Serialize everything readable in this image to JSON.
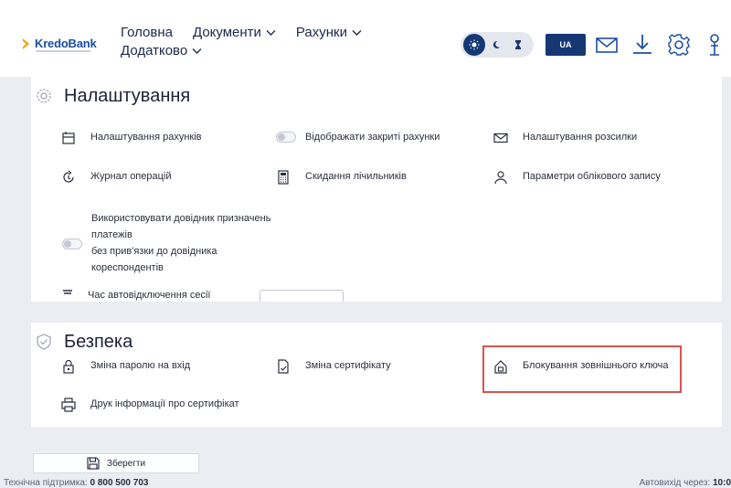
{
  "app": {
    "logo_text": "KredoBank",
    "colors": {
      "brand": "#1b4ea3",
      "brand_dark": "#153875",
      "accent": "#f5a500",
      "highlight": "#d9534f"
    }
  },
  "nav": {
    "home": "Головна",
    "documents": "Документи",
    "accounts": "Рахунки",
    "extra": "Додатково"
  },
  "header": {
    "lang": "UA",
    "theme_modes": [
      "sun",
      "moon",
      "hourglass"
    ],
    "icons": [
      "mail-icon",
      "download-icon",
      "gear-icon",
      "user-icon"
    ]
  },
  "settings": {
    "title": "Налаштування",
    "items": [
      {
        "label": "Налаштування рахунків",
        "icon": "account-settings-icon"
      },
      {
        "label": "Відображати закриті рахунки",
        "icon": "toggle"
      },
      {
        "label": "Налаштування розсилки",
        "icon": "envelope-icon"
      },
      {
        "label": "Журнал операцій",
        "icon": "history-icon"
      },
      {
        "label": "Скидання лічильників",
        "icon": "calculator-icon"
      },
      {
        "label": "Параметри облікового запису",
        "icon": "person-icon"
      }
    ],
    "directory_lines": [
      "Використовувати довідник призначень",
      "платежів",
      "без прив'язки до довідника",
      "кореспондентів"
    ],
    "partial_label": "Час автовідключення сесії"
  },
  "security": {
    "title": "Безпека",
    "items": [
      {
        "label": "Зміна паролю на вхід",
        "icon": "lock-icon"
      },
      {
        "label": "Зміна сертифікату",
        "icon": "certificate-icon"
      },
      {
        "label": "Блокування зовнішнього ключа",
        "icon": "key-lock-icon"
      },
      {
        "label": "Друк інформації про сертифікат",
        "icon": "printer-icon"
      }
    ]
  },
  "actions": {
    "save": "Зберегти"
  },
  "footer": {
    "support_label": "Технічна підтримка:",
    "support_phone": "0 800 500 703",
    "autologout_label": "Автовихід через:",
    "autologout_time": "10:0"
  }
}
